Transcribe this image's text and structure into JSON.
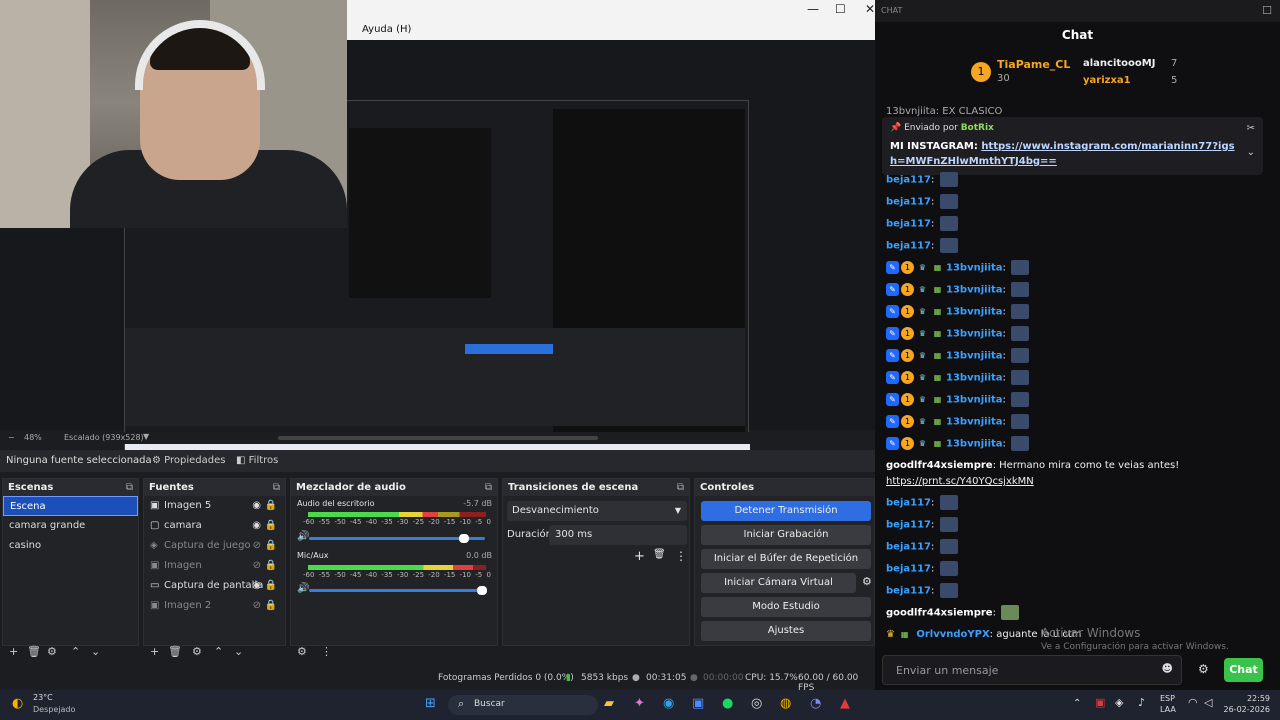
{
  "obs": {
    "menu_help": "Ayuda (H)",
    "zoom": "48%",
    "scaled": "Escalado (939x528)",
    "no_source": "Ninguna fuente seleccionada",
    "properties": "Propiedades",
    "filters": "Filtros",
    "scenes": {
      "title": "Escenas",
      "items": [
        "Escena",
        "camara grande",
        "casino"
      ]
    },
    "sources": {
      "title": "Fuentes",
      "items": [
        {
          "label": "Imagen 5",
          "visible": true
        },
        {
          "label": "camara",
          "visible": true
        },
        {
          "label": "Captura de juego",
          "visible": false
        },
        {
          "label": "Imagen",
          "visible": false
        },
        {
          "label": "Captura de pantalla",
          "visible": true
        },
        {
          "label": "Imagen 2",
          "visible": false
        }
      ]
    },
    "mixer": {
      "title": "Mezclador de audio",
      "ch1": {
        "name": "Audio del escritorio",
        "db": "-5.7 dB"
      },
      "ch2": {
        "name": "Mic/Aux",
        "db": "0.0 dB"
      },
      "ticks": "-60 -55 -50 -45 -40 -35 -30 -25 -20 -15 -10 -5 0"
    },
    "transitions": {
      "title": "Transiciones de escena",
      "type": "Desvanecimiento",
      "duration_label": "Duración",
      "duration_value": "300 ms"
    },
    "controls": {
      "title": "Controles",
      "buttons": [
        "Detener Transmisión",
        "Iniciar Grabación",
        "Iniciar el Búfer de Repetición",
        "Iniciar Cámara Virtual",
        "Modo Estudio",
        "Ajustes"
      ]
    },
    "status": {
      "dropped": "Fotogramas Perdidos 0 (0.0%)",
      "kbps": "5853 kbps",
      "stream_time": "00:31:05",
      "rec_time": "00:00:00",
      "cpu": "CPU: 15.7%",
      "fps": "60.00 / 60.00 FPS"
    }
  },
  "chat": {
    "window_title": "CHAT",
    "header": "Chat",
    "leaderboard": [
      {
        "rank": "1",
        "name": "TiaPame_CL",
        "score": "30"
      },
      {
        "name": "alancitoooMJ",
        "score": "7"
      },
      {
        "name": "yarizxa1",
        "score": "5"
      }
    ],
    "pinned": {
      "prefix": "Enviado por",
      "by": "BotRix",
      "label": "MI INSTAGRAM:",
      "link": "https://www.instagram.com/marianinn77?igsh=MWFnZHlwMmthYTJ4bg=="
    },
    "partial_top": "13bvnjiita: EX CLASICO",
    "messages": [
      {
        "user": "beja117",
        "text": ""
      },
      {
        "user": "beja117",
        "text": ""
      },
      {
        "user": "beja117",
        "text": ""
      },
      {
        "user": "beja117",
        "text": ""
      },
      {
        "user": "13bvnjiita",
        "text": ""
      },
      {
        "user": "13bvnjiita",
        "text": ""
      },
      {
        "user": "13bvnjiita",
        "text": ""
      },
      {
        "user": "13bvnjiita",
        "text": ""
      },
      {
        "user": "13bvnjiita",
        "text": ""
      },
      {
        "user": "13bvnjiita",
        "text": ""
      },
      {
        "user": "13bvnjiita",
        "text": ""
      },
      {
        "user": "13bvnjiita",
        "text": ""
      },
      {
        "user": "13bvnjiita",
        "text": ""
      }
    ],
    "goodlfr_msg": {
      "user": "goodlfr44xsiempre",
      "text": "Hermano mira como te veias antes!",
      "link": "https://prnt.sc/Y40YQcsjxkMN"
    },
    "messages2": [
      "beja117",
      "beja117",
      "beja117",
      "beja117",
      "beja117"
    ],
    "goodlfr2": "goodlfr44xsiempre",
    "last": {
      "user": "OrlvvndoYPX",
      "text": "aguante la u ctm"
    },
    "input_placeholder": "Enviar un mensaje",
    "send": "Chat",
    "watermark1": "Activar Windows",
    "watermark2": "Ve a Configuración para activar Windows."
  },
  "taskbar": {
    "weather_temp": "23°C",
    "weather_desc": "Despejado",
    "search": "Buscar",
    "lang1": "ESP",
    "lang2": "LAA",
    "time": "22:59",
    "date": "26-02-2026"
  }
}
